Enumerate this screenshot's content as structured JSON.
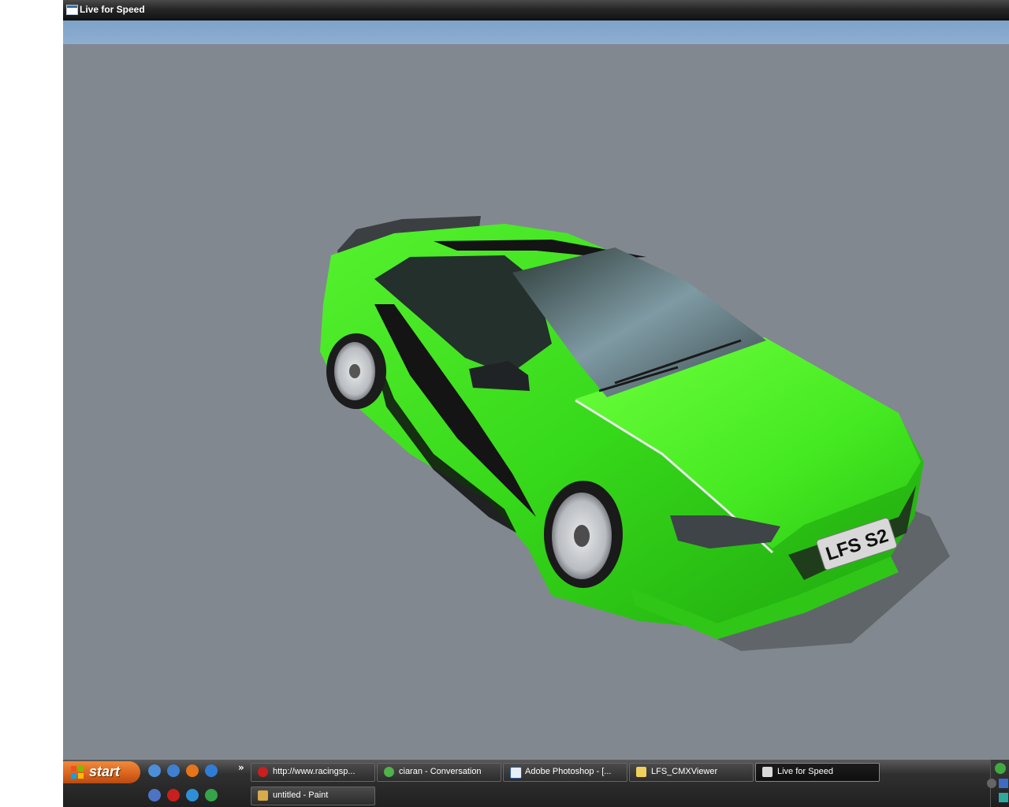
{
  "window": {
    "title": "Live for Speed"
  },
  "scene": {
    "license_plate": "LFS S2",
    "car_color": "#3ee01f",
    "sky_color": "#8aaed0",
    "ground_color": "#82888f"
  },
  "taskbar": {
    "start_label": "start",
    "quick_launch": [
      "messenger-icon",
      "media-player-icon",
      "firefox-icon",
      "internet-explorer-icon",
      "security-icon",
      "opera-icon",
      "search-icon",
      "msn-icon"
    ],
    "tasks": [
      {
        "label": "http://www.racingsp...",
        "icon": "opera-icon"
      },
      {
        "label": "ciaran - Conversation",
        "icon": "messenger-icon"
      },
      {
        "label": "Adobe Photoshop - [...",
        "icon": "photoshop-icon"
      },
      {
        "label": "LFS_CMXViewer",
        "icon": "folder-icon"
      },
      {
        "label": "Live for Speed",
        "icon": "lfs-icon",
        "active": true
      },
      {
        "label": "untitled - Paint",
        "icon": "paint-icon"
      }
    ]
  }
}
